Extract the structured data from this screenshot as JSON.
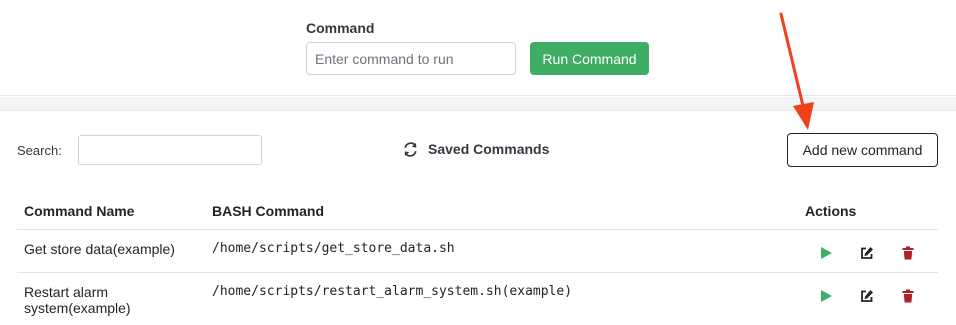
{
  "top": {
    "label": "Command",
    "input_placeholder": "Enter command to run",
    "run_button": "Run Command"
  },
  "toolbar": {
    "search_label": "Search:",
    "saved_commands": "Saved Commands",
    "add_button": "Add new command"
  },
  "table": {
    "headers": [
      "Command Name",
      "BASH Command",
      "Actions"
    ],
    "rows": [
      {
        "name": "Get store data(example)",
        "command": "/home/scripts/get_store_data.sh"
      },
      {
        "name": "Restart alarm system(example)",
        "command": "/home/scripts/restart_alarm_system.sh(example)"
      }
    ]
  },
  "colors": {
    "run_button": "#3dae63",
    "play_icon": "#3dae63",
    "delete_icon": "#b0202a",
    "arrow": "#f0401c"
  },
  "icons": [
    "refresh-icon",
    "play-icon",
    "edit-icon",
    "trash-icon"
  ]
}
